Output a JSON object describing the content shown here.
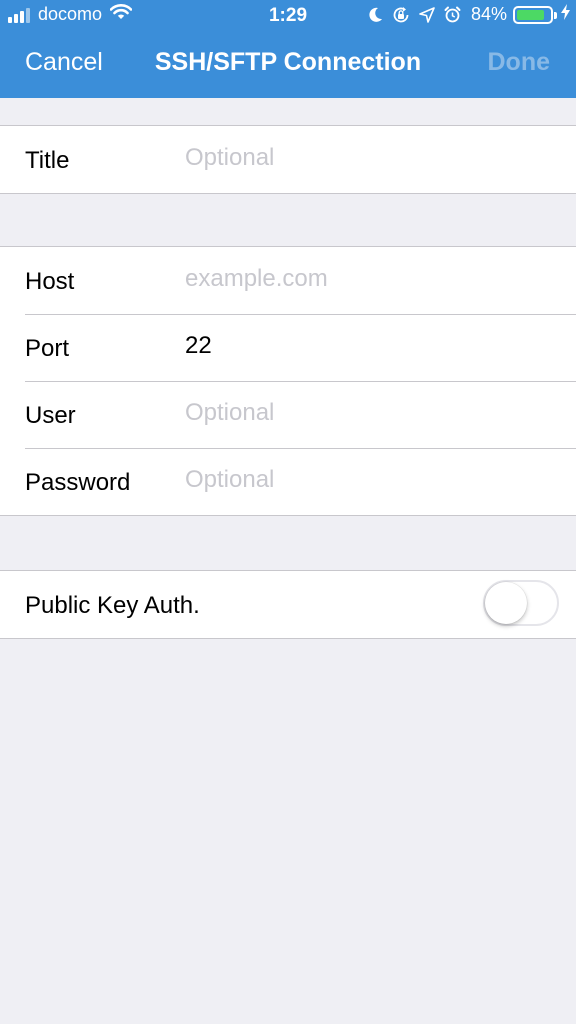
{
  "status_bar": {
    "carrier": "docomo",
    "time": "1:29",
    "battery_percent": "84%",
    "battery_level": 0.84,
    "battery_color": "#4cd964",
    "icons": [
      "signal-icon",
      "wifi-icon",
      "moon-icon",
      "orientation-lock-icon",
      "location-icon",
      "alarm-icon",
      "battery-icon",
      "charging-bolt-icon"
    ]
  },
  "nav": {
    "cancel_label": "Cancel",
    "title": "SSH/SFTP Connection",
    "done_label": "Done"
  },
  "colors": {
    "nav_background": "#3b8ed9",
    "page_background": "#efeff4",
    "placeholder": "#c7c7cd",
    "done_disabled": "#88b9e6"
  },
  "form": {
    "title": {
      "label": "Title",
      "value": "",
      "placeholder": "Optional"
    },
    "host": {
      "label": "Host",
      "value": "",
      "placeholder": "example.com"
    },
    "port": {
      "label": "Port",
      "value": "22",
      "placeholder": ""
    },
    "user": {
      "label": "User",
      "value": "",
      "placeholder": "Optional"
    },
    "password": {
      "label": "Password",
      "value": "",
      "placeholder": "Optional"
    },
    "public_key_auth": {
      "label": "Public Key Auth.",
      "enabled": false
    }
  }
}
